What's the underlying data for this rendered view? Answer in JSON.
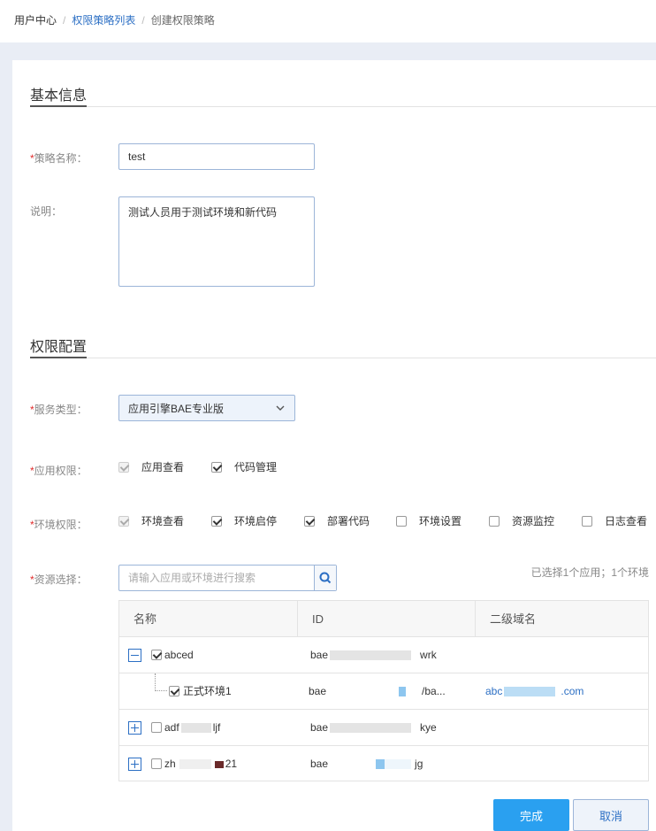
{
  "breadcrumb": {
    "items": [
      "用户中心",
      "权限策略列表",
      "创建权限策略"
    ],
    "separator": "/"
  },
  "basic_info": {
    "title": "基本信息",
    "name_label": "策略名称：",
    "name_value": "test",
    "desc_label": "说明：",
    "desc_value": "测试人员用于测试环境和新代码"
  },
  "permission": {
    "title": "权限配置",
    "service_label": "服务类型：",
    "service_value": "应用引擎BAE专业版",
    "app_label": "应用权限：",
    "app_options": [
      {
        "label": "应用查看",
        "checked": true,
        "disabled": true
      },
      {
        "label": "代码管理",
        "checked": true,
        "disabled": false
      }
    ],
    "env_label": "环境权限：",
    "env_options": [
      {
        "label": "环境查看",
        "checked": true,
        "disabled": true
      },
      {
        "label": "环境启停",
        "checked": true,
        "disabled": false
      },
      {
        "label": "部署代码",
        "checked": true,
        "disabled": false
      },
      {
        "label": "环境设置",
        "checked": false,
        "disabled": false
      },
      {
        "label": "资源监控",
        "checked": false,
        "disabled": false
      },
      {
        "label": "日志查看",
        "checked": false,
        "disabled": false
      }
    ],
    "resource_label": "资源选择：",
    "search_placeholder": "请输入应用或环境进行搜索",
    "selected_summary": "已选择1个应用；1个环境"
  },
  "table": {
    "headers": [
      "名称",
      "ID",
      "二级域名"
    ],
    "rows": [
      {
        "name_prefix": "abced",
        "name_suffix": "",
        "id_prefix": "bae",
        "id_suffix": "wrk",
        "domain": "",
        "expanded": true,
        "checked": true
      },
      {
        "name_prefix": "正式环境1",
        "name_suffix": "",
        "id_prefix": "bae",
        "id_suffix": "/ba...",
        "domain_prefix": "abc",
        "domain_suffix": ".com",
        "child": true,
        "checked": true
      },
      {
        "name_prefix": "adf",
        "name_suffix": "ljf",
        "id_prefix": "bae",
        "id_suffix": "kye",
        "domain": "",
        "expanded": false,
        "checked": false
      },
      {
        "name_prefix": "zh",
        "name_suffix": "21",
        "id_prefix": "bae",
        "id_suffix": "jg",
        "domain": "",
        "expanded": false,
        "checked": false
      }
    ]
  },
  "actions": {
    "confirm": "完成",
    "cancel": "取消"
  },
  "colors": {
    "accent": "#2aa0f0",
    "link": "#2c6fc4",
    "required": "#e02b2b"
  }
}
